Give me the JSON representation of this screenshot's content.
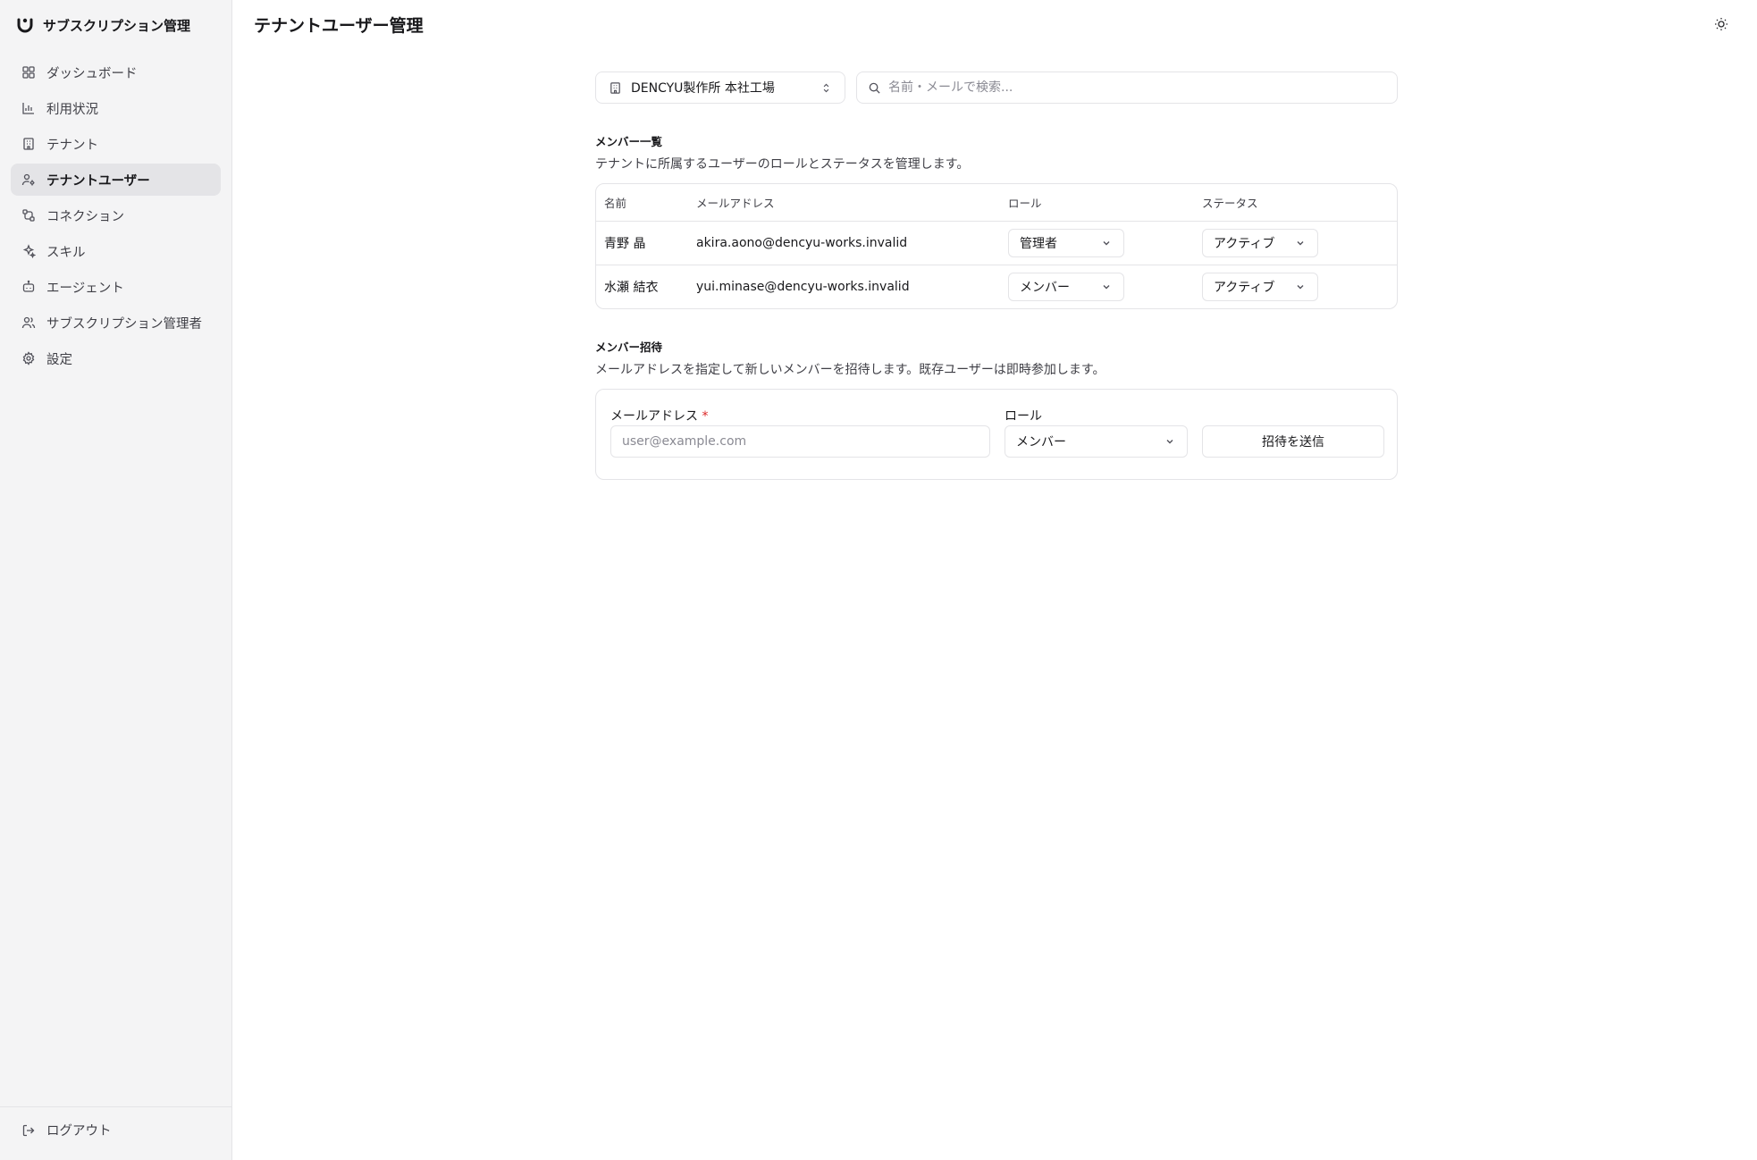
{
  "app": {
    "title": "サブスクリプション管理"
  },
  "sidebar": {
    "items": [
      {
        "label": "ダッシュボード",
        "icon": "dashboard-icon"
      },
      {
        "label": "利用状況",
        "icon": "bar-chart-icon"
      },
      {
        "label": "テナント",
        "icon": "building-icon"
      },
      {
        "label": "テナントユーザー",
        "icon": "user-cog-icon",
        "active": true
      },
      {
        "label": "コネクション",
        "icon": "cable-icon"
      },
      {
        "label": "スキル",
        "icon": "sparkles-icon"
      },
      {
        "label": "エージェント",
        "icon": "bot-icon"
      },
      {
        "label": "サブスクリプション管理者",
        "icon": "users-icon"
      },
      {
        "label": "設定",
        "icon": "gear-icon"
      }
    ],
    "logout_label": "ログアウト"
  },
  "header": {
    "title": "テナントユーザー管理",
    "theme_icon": "sun-icon"
  },
  "toolbar": {
    "tenant": "DENCYU製作所 本社工場",
    "search_placeholder": "名前・メールで検索..."
  },
  "members": {
    "title": "メンバー一覧",
    "description": "テナントに所属するユーザーのロールとステータスを管理します。",
    "columns": [
      "名前",
      "メールアドレス",
      "ロール",
      "ステータス"
    ],
    "rows": [
      {
        "name": "青野 晶",
        "email": "akira.aono@dencyu-works.invalid",
        "role": "管理者",
        "status": "アクティブ"
      },
      {
        "name": "水瀬 結衣",
        "email": "yui.minase@dencyu-works.invalid",
        "role": "メンバー",
        "status": "アクティブ"
      }
    ]
  },
  "invite": {
    "title": "メンバー招待",
    "description": "メールアドレスを指定して新しいメンバーを招待します。既存ユーザーは即時参加します。",
    "email_label": "メールアドレス",
    "required_mark": "*",
    "email_placeholder": "user@example.com",
    "role_label": "ロール",
    "role_value": "メンバー",
    "submit_label": "招待を送信"
  },
  "colors": {
    "sidebar_bg": "#f4f4f5",
    "active_bg": "#e4e4e7",
    "border": "#e4e4e7",
    "required": "#dc2626"
  }
}
